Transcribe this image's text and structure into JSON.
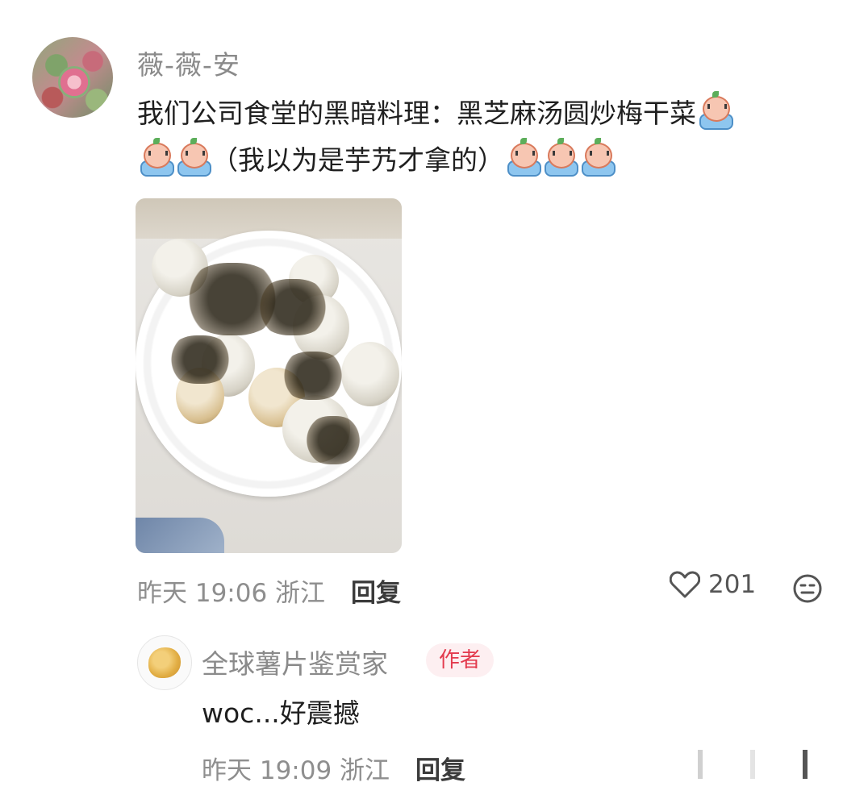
{
  "comment": {
    "username": "薇-薇-安",
    "text_line1": "我们公司食堂的黑暗料理：黑芝麻汤圆炒梅干菜",
    "text_line2": "（我以为是芋艿才拿的）",
    "emoji_name": "crying-face-emoji",
    "meta_time": "昨天 19:06 浙江",
    "reply_label": "回复",
    "like_count": "201"
  },
  "reply": {
    "username": "全球薯片鉴赏家",
    "badge": "作者",
    "text": "woc...好震撼",
    "meta_time": "昨天 19:09 浙江",
    "reply_label": "回复"
  },
  "colors": {
    "meta_gray": "#8e8e8e",
    "author_badge_red": "#e33b4e",
    "author_badge_bg": "#fdeff1"
  }
}
